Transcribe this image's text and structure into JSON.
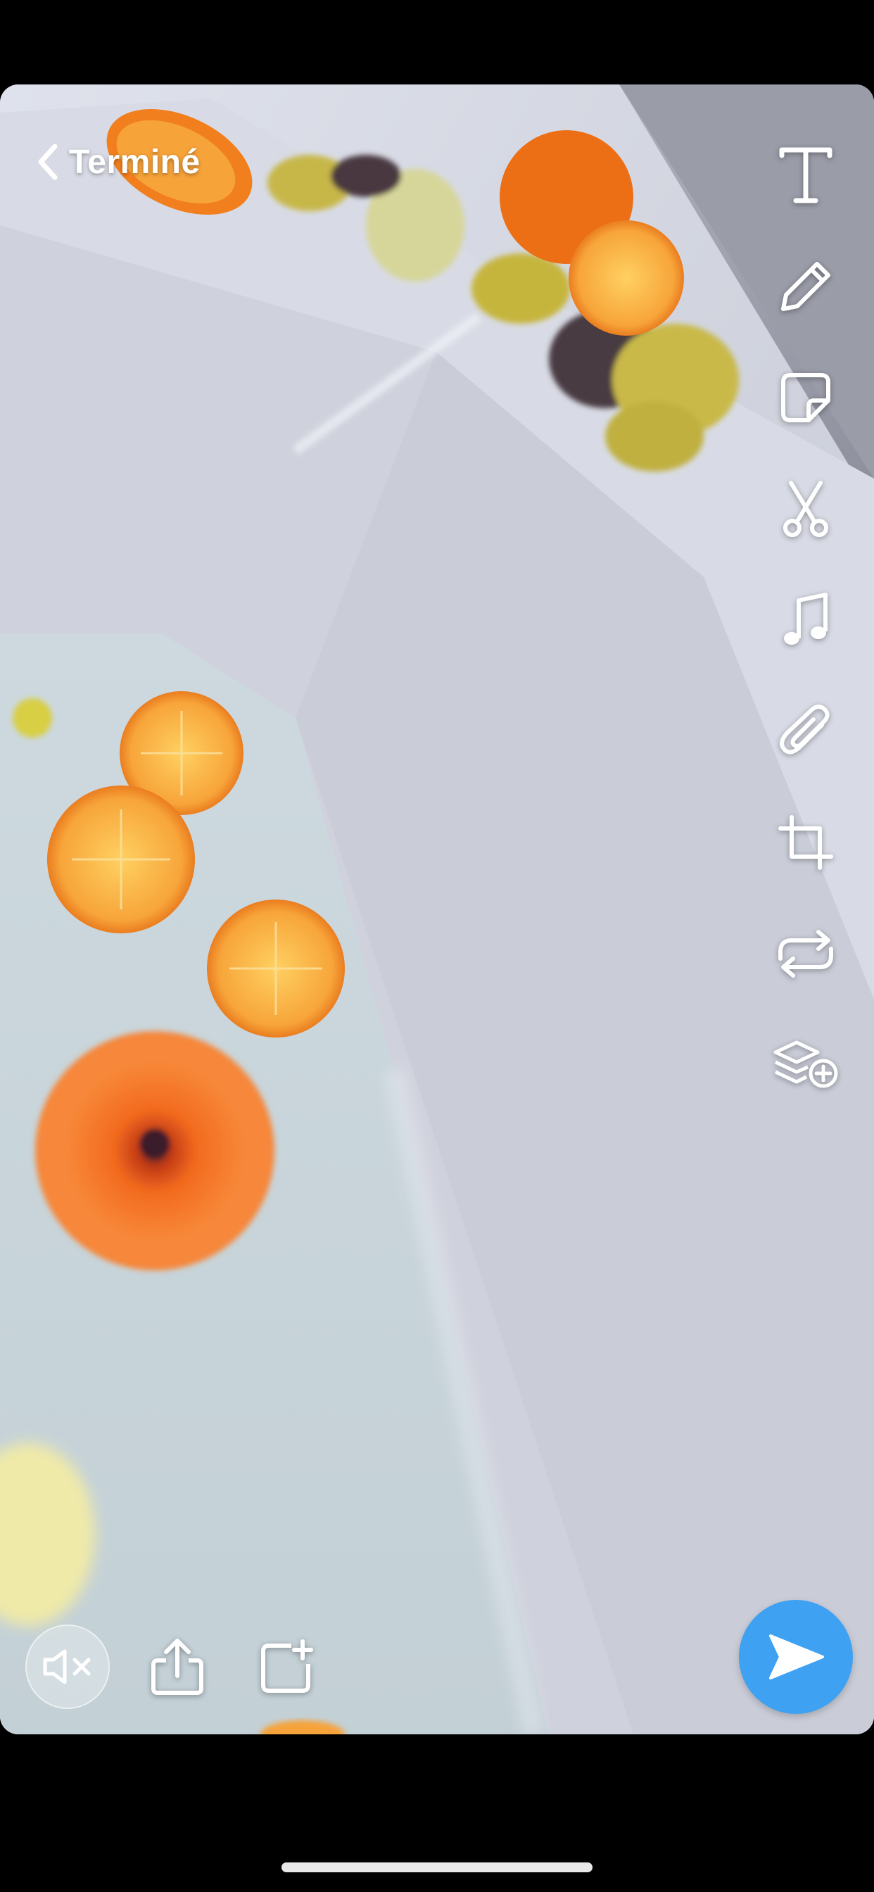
{
  "header": {
    "back_label": "Terminé"
  },
  "tools": [
    {
      "name": "text-tool",
      "icon": "text-T-icon"
    },
    {
      "name": "draw-tool",
      "icon": "pencil-icon"
    },
    {
      "name": "sticker-tool",
      "icon": "sticker-icon"
    },
    {
      "name": "scissors-tool",
      "icon": "scissors-icon"
    },
    {
      "name": "music-tool",
      "icon": "music-note-icon"
    },
    {
      "name": "attachment-tool",
      "icon": "paperclip-icon"
    },
    {
      "name": "crop-tool",
      "icon": "crop-icon"
    },
    {
      "name": "loop-tool",
      "icon": "loop-arrows-icon"
    },
    {
      "name": "layers-tool",
      "icon": "layers-add-icon"
    }
  ],
  "bottom_bar": {
    "mute_icon": "speaker-muted-icon",
    "export_icon": "share-export-icon",
    "add_story_icon": "add-to-story-icon",
    "send_icon": "send-arrow-icon"
  },
  "colors": {
    "send_button": "#3ea1f2",
    "icon": "#ffffff",
    "background": "#000000"
  }
}
